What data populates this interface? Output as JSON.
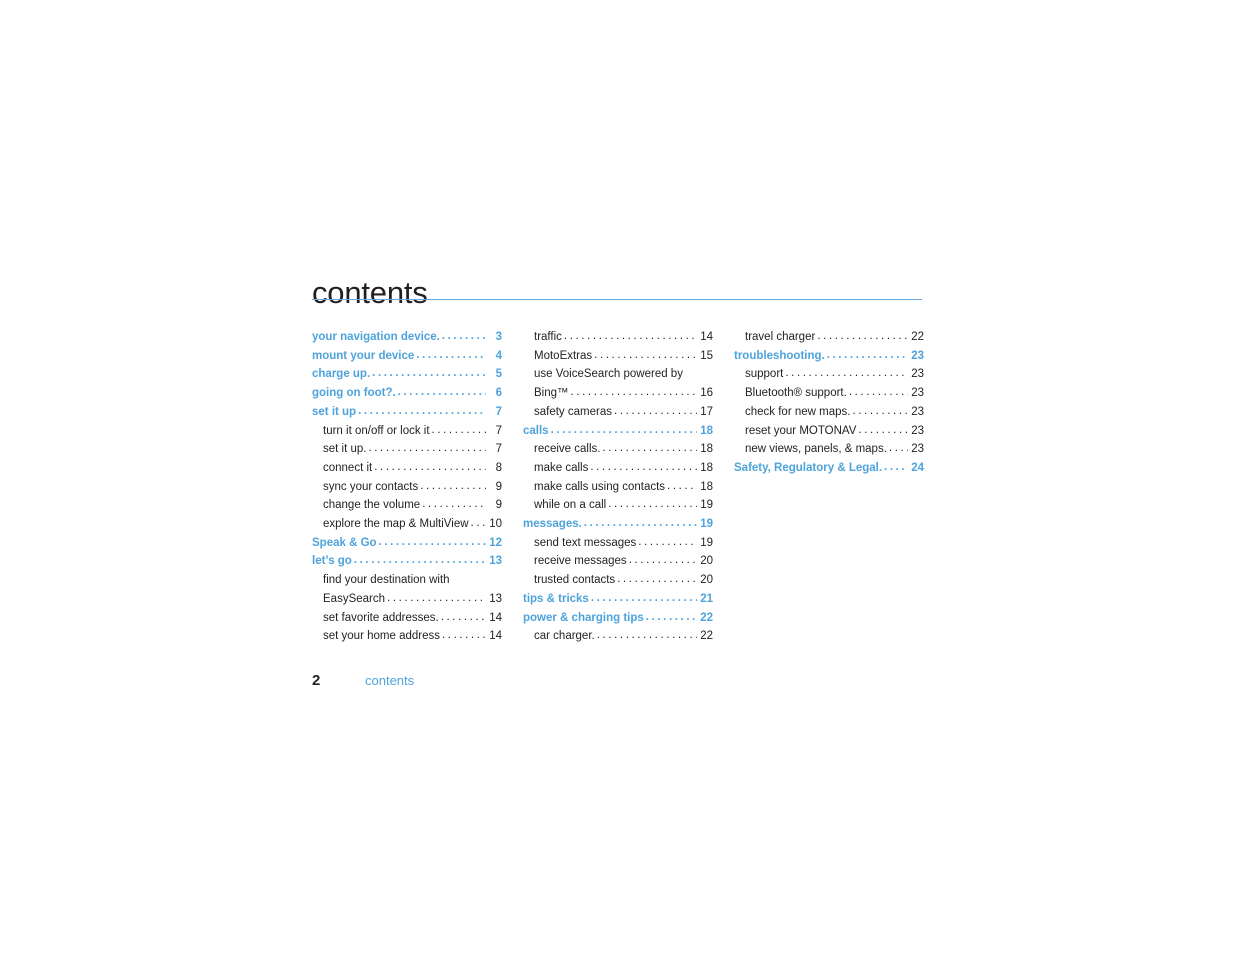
{
  "document": {
    "title": "contents",
    "footer": {
      "page_number": "2",
      "label": "contents"
    },
    "accent_color": "#4ea3dc",
    "rule_color": "#6aa9dd",
    "text_color": "#231f20"
  },
  "columns": [
    {
      "entries": [
        {
          "level": 1,
          "label": "your navigation device.",
          "page": "3",
          "leader": true
        },
        {
          "level": 1,
          "label": "mount your device",
          "page": "4",
          "leader": true
        },
        {
          "level": 1,
          "label": "charge up.",
          "page": "5",
          "leader": true
        },
        {
          "level": 1,
          "label": "going on foot?.",
          "page": "6",
          "leader": true
        },
        {
          "level": 1,
          "label": "set it up",
          "page": "7",
          "leader": true
        },
        {
          "level": 2,
          "label": "turn it on/off or lock it",
          "page": "7",
          "leader": true
        },
        {
          "level": 2,
          "label": "set it up.",
          "page": "7",
          "leader": true
        },
        {
          "level": 2,
          "label": "connect it",
          "page": "8",
          "leader": true
        },
        {
          "level": 2,
          "label": "sync your contacts",
          "page": "9",
          "leader": true
        },
        {
          "level": 2,
          "label": "change the volume",
          "page": "9",
          "leader": true
        },
        {
          "level": 2,
          "label": "explore the map & MultiView",
          "page": "10",
          "leader": true
        },
        {
          "level": 1,
          "label": "Speak & Go",
          "page": "12",
          "leader": true
        },
        {
          "level": 1,
          "label": "let’s go",
          "page": "13",
          "leader": true
        },
        {
          "level": 2,
          "label": "find your destination with",
          "page": "",
          "leader": false
        },
        {
          "level": 2,
          "label": "EasySearch",
          "page": "13",
          "leader": true
        },
        {
          "level": 2,
          "label": "set favorite addresses.",
          "page": "14",
          "leader": true
        },
        {
          "level": 2,
          "label": "set your home address",
          "page": "14",
          "leader": true
        }
      ]
    },
    {
      "entries": [
        {
          "level": 2,
          "label": "traffic",
          "page": "14",
          "leader": true
        },
        {
          "level": 2,
          "label": "MotoExtras",
          "page": "15",
          "leader": true
        },
        {
          "level": 2,
          "label": "use VoiceSearch powered by",
          "page": "",
          "leader": false
        },
        {
          "level": 2,
          "label": "Bing™",
          "page": "16",
          "leader": true
        },
        {
          "level": 2,
          "label": "safety cameras",
          "page": "17",
          "leader": true
        },
        {
          "level": 1,
          "label": "calls",
          "page": "18",
          "leader": true
        },
        {
          "level": 2,
          "label": "receive calls.",
          "page": "18",
          "leader": true
        },
        {
          "level": 2,
          "label": "make calls",
          "page": "18",
          "leader": true
        },
        {
          "level": 2,
          "label": "make calls using contacts",
          "page": "18",
          "leader": true
        },
        {
          "level": 2,
          "label": "while on a call",
          "page": "19",
          "leader": true
        },
        {
          "level": 1,
          "label": "messages.",
          "page": "19",
          "leader": true
        },
        {
          "level": 2,
          "label": "send text messages",
          "page": "19",
          "leader": true
        },
        {
          "level": 2,
          "label": "receive messages",
          "page": "20",
          "leader": true
        },
        {
          "level": 2,
          "label": "trusted contacts",
          "page": "20",
          "leader": true
        },
        {
          "level": 1,
          "label": "tips & tricks",
          "page": "21",
          "leader": true
        },
        {
          "level": 1,
          "label": "power & charging tips",
          "page": "22",
          "leader": true
        },
        {
          "level": 2,
          "label": "car charger.",
          "page": "22",
          "leader": true
        }
      ]
    },
    {
      "entries": [
        {
          "level": 2,
          "label": "travel charger",
          "page": "22",
          "leader": true
        },
        {
          "level": 1,
          "label": "troubleshooting.",
          "page": "23",
          "leader": true
        },
        {
          "level": 2,
          "label": "support",
          "page": "23",
          "leader": true
        },
        {
          "level": 2,
          "label": "Bluetooth® support.",
          "page": "23",
          "leader": true
        },
        {
          "level": 2,
          "label": "check for new maps.",
          "page": "23",
          "leader": true
        },
        {
          "level": 2,
          "label": "reset your MOTONAV",
          "page": "23",
          "leader": true
        },
        {
          "level": 2,
          "label": "new views, panels, & maps.",
          "page": "23",
          "leader": true
        },
        {
          "level": 1,
          "label": "Safety, Regulatory & Legal.",
          "page": "24",
          "leader": true
        }
      ]
    }
  ]
}
